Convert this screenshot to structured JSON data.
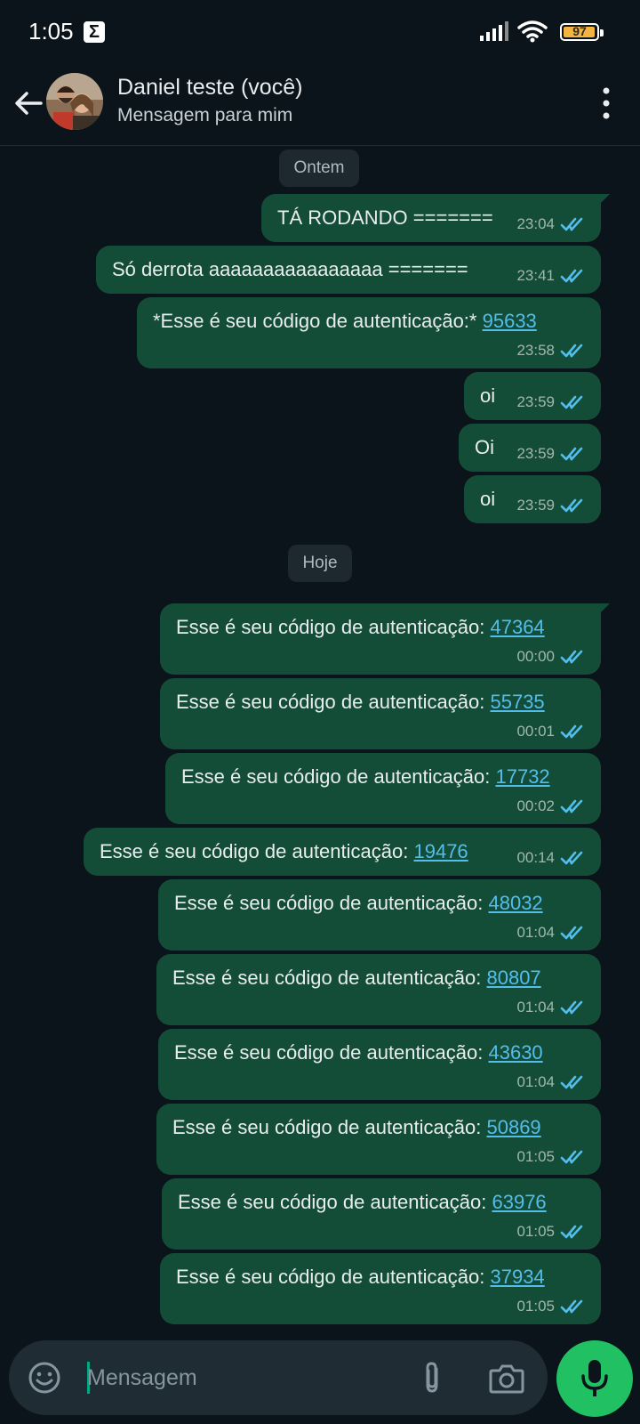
{
  "status_bar": {
    "time": "1:05",
    "battery": "97",
    "battery_level": 0.97
  },
  "header": {
    "contact_name": "Daniel teste (você)",
    "subtitle": "Mensagem para mim"
  },
  "dates": {
    "yesterday": "Ontem",
    "today": "Hoje"
  },
  "messages_yesterday": [
    {
      "text": "TÁ RODANDO =======",
      "code": "",
      "time": "23:04"
    },
    {
      "text": "Só derrota aaaaaaaaaaaaaaaa =======",
      "code": "",
      "time": "23:41"
    },
    {
      "text": "*Esse é seu código de autenticação:*",
      "code": "95633",
      "time": "23:58"
    },
    {
      "text": "oi",
      "code": "",
      "time": "23:59"
    },
    {
      "text": "Oi",
      "code": "",
      "time": "23:59"
    },
    {
      "text": "oi",
      "code": "",
      "time": "23:59"
    }
  ],
  "messages_today": [
    {
      "text": "Esse é seu código de autenticação:",
      "code": "47364",
      "time": "00:00"
    },
    {
      "text": "Esse é seu código de autenticação:",
      "code": "55735",
      "time": "00:01"
    },
    {
      "text": "Esse é seu código de autenticação:",
      "code": "17732",
      "time": "00:02"
    },
    {
      "text": "Esse é seu código de autenticação:",
      "code": "19476",
      "time": "00:14"
    },
    {
      "text": "Esse é seu código de autenticação:",
      "code": "48032",
      "time": "01:04"
    },
    {
      "text": "Esse é seu código de autenticação:",
      "code": "80807",
      "time": "01:04"
    },
    {
      "text": "Esse é seu código de autenticação:",
      "code": "43630",
      "time": "01:04"
    },
    {
      "text": "Esse é seu código de autenticação:",
      "code": "50869",
      "time": "01:05"
    },
    {
      "text": "Esse é seu código de autenticação:",
      "code": "63976",
      "time": "01:05"
    },
    {
      "text": "Esse é seu código de autenticação:",
      "code": "37934",
      "time": "01:05"
    }
  ],
  "composer": {
    "placeholder": "Mensagem"
  },
  "colors": {
    "bubble": "#144d37",
    "link": "#53bdeb",
    "read_ticks": "#53bdeb",
    "mic_button": "#21c063"
  }
}
